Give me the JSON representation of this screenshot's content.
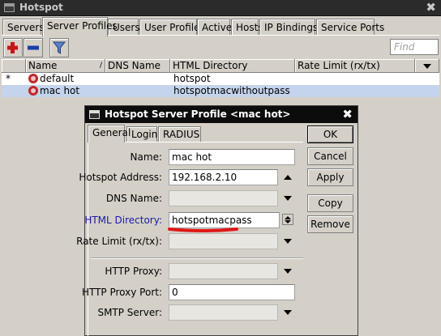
{
  "window": {
    "title": "Hotspot",
    "close_glyph": "✖"
  },
  "tabs": [
    "Servers",
    "Server Profiles",
    "Users",
    "User Profiles",
    "Active",
    "Hosts",
    "IP Bindings",
    "Service Ports"
  ],
  "toolbar": {
    "find_placeholder": "Find",
    "add_icon": "plus-icon",
    "remove_icon": "minus-icon",
    "filter_icon": "filter-icon"
  },
  "table": {
    "columns": [
      "Name",
      "DNS Name",
      "HTML Directory",
      "Rate Limit (rx/tx)"
    ],
    "rows": [
      {
        "flag": "*",
        "name": "default",
        "dns": "",
        "html_dir": "hotspot",
        "rate": ""
      },
      {
        "flag": "",
        "name": "mac hot",
        "dns": "",
        "html_dir": "hotspotmacwithoutpass",
        "rate": ""
      }
    ]
  },
  "dialog": {
    "title": "Hotspot Server Profile <mac hot>",
    "tabs": [
      "General",
      "Login",
      "RADIUS"
    ],
    "fields": {
      "name": {
        "label": "Name:",
        "value": "mac hot"
      },
      "hotspot_address": {
        "label": "Hotspot Address:",
        "value": "192.168.2.10"
      },
      "dns_name": {
        "label": "DNS Name:",
        "value": ""
      },
      "html_directory": {
        "label": "HTML Directory:",
        "value": "hotspotmacpass"
      },
      "rate_limit": {
        "label": "Rate Limit (rx/tx):",
        "value": ""
      },
      "http_proxy": {
        "label": "HTTP Proxy:",
        "value": ""
      },
      "http_proxy_port": {
        "label": "HTTP Proxy Port:",
        "value": "0"
      },
      "smtp_server": {
        "label": "SMTP Server:",
        "value": ""
      }
    },
    "buttons": {
      "ok": "OK",
      "cancel": "Cancel",
      "apply": "Apply",
      "copy": "Copy",
      "remove": "Remove"
    }
  },
  "colors": {
    "selected_row": "#c4d4ec",
    "link_label": "#1a1aa8",
    "annotation_underline": "#e01818",
    "plus": "#c41616",
    "minus": "#1a3fa6"
  }
}
